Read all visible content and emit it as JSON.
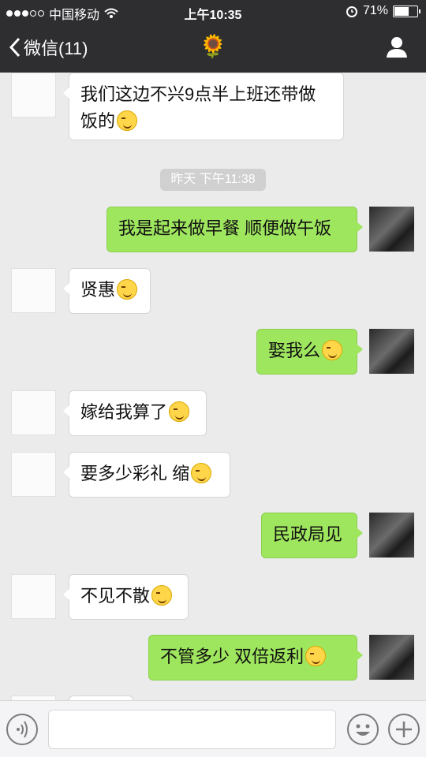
{
  "status": {
    "carrier": "中国移动",
    "time": "上午10:35",
    "battery": "71%",
    "battery_level": 0.71
  },
  "nav": {
    "back_label": "微信(11)",
    "title": "🌻"
  },
  "chat": {
    "timestamp": "昨天 下午11:38",
    "messages": [
      {
        "side": "left",
        "line1": "我们这边不兴9点半上班还带做",
        "line2": "饭的"
      },
      {
        "side": "right",
        "text": "我是起来做早餐 顺便做午饭"
      },
      {
        "side": "left",
        "text": "贤惠"
      },
      {
        "side": "right",
        "text": "娶我么"
      },
      {
        "side": "left",
        "text": "嫁给我算了"
      },
      {
        "side": "left",
        "text": "要多少彩礼 缩"
      },
      {
        "side": "right",
        "text": "民政局见"
      },
      {
        "side": "left",
        "text": "不见不散"
      },
      {
        "side": "right",
        "text": "不管多少   双倍返利"
      }
    ]
  },
  "icons": {
    "wifi": "wifi-icon",
    "alarm": "alarm-icon",
    "back": "chevron-left-icon",
    "profile": "person-icon",
    "voice": "voice-icon",
    "emoji": "smile-icon",
    "plus": "plus-icon"
  },
  "colors": {
    "bar_bg": "#2e2e31",
    "chat_bg": "#ebebeb",
    "my_bubble": "#9fe65f",
    "their_bubble": "#ffffff"
  }
}
